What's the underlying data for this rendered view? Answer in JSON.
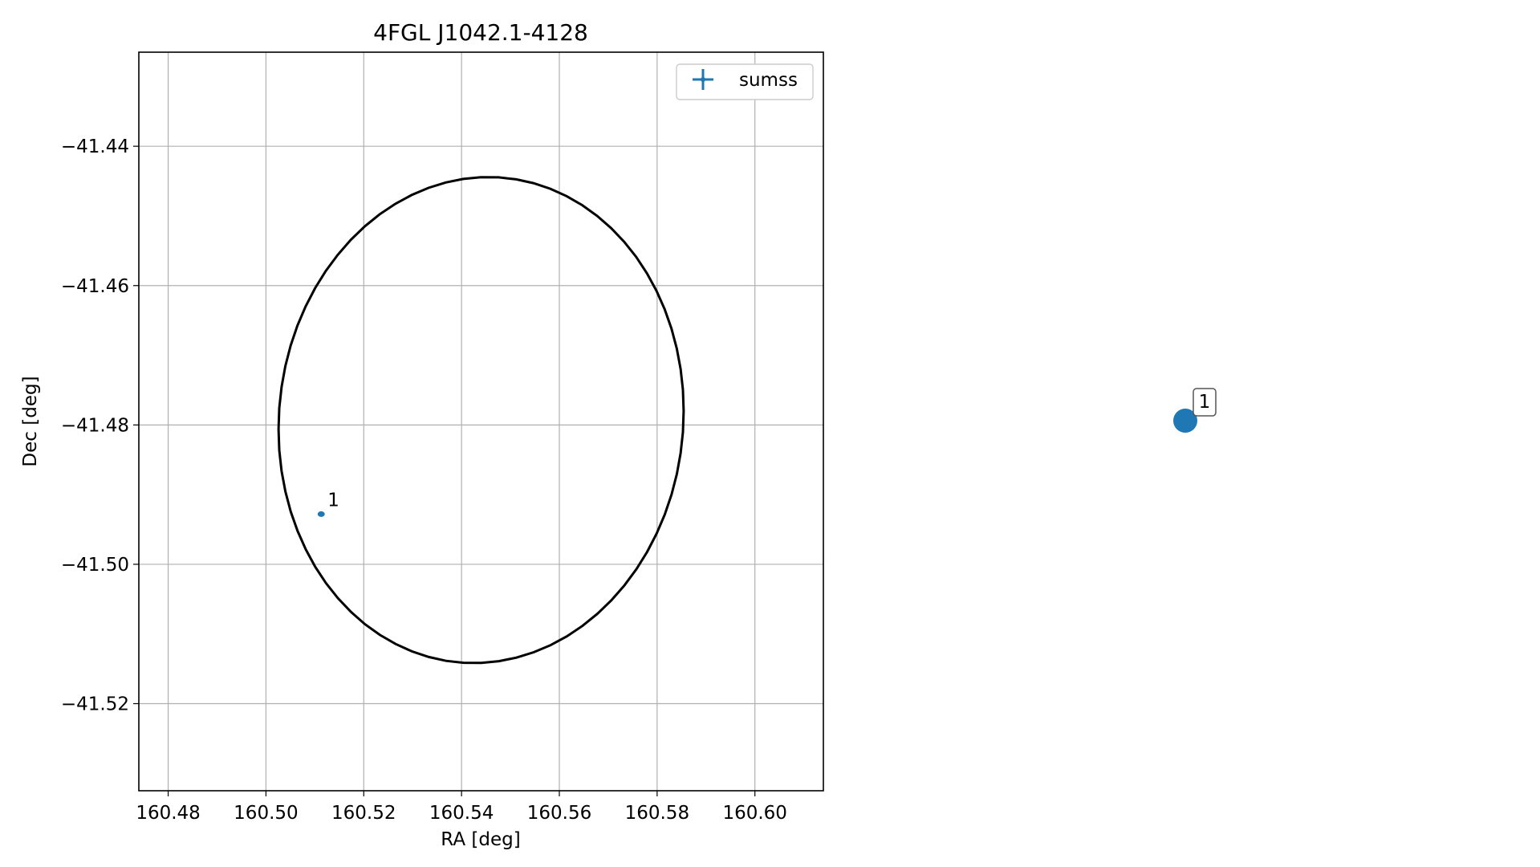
{
  "chart_data": [
    {
      "type": "scatter",
      "title": "4FGL J1042.1-4128",
      "xlabel": "RA [deg]",
      "ylabel": "Dec [deg]",
      "xlim": [
        160.474,
        160.614
      ],
      "ylim": [
        -41.5325,
        -41.4265
      ],
      "xticks": [
        160.48,
        160.5,
        160.52,
        160.54,
        160.56,
        160.58,
        160.6
      ],
      "xtick_labels": [
        "160.48",
        "160.50",
        "160.52",
        "160.54",
        "160.56",
        "160.58",
        "160.60"
      ],
      "yticks": [
        -41.44,
        -41.46,
        -41.48,
        -41.5,
        -41.52
      ],
      "ytick_labels": [
        "−41.44",
        "−41.46",
        "−41.48",
        "−41.50",
        "−41.52"
      ],
      "grid": true,
      "legend": {
        "placement": "top-right",
        "entries": [
          {
            "label": "sumss",
            "color": "#1f77b4"
          }
        ]
      },
      "ellipse": {
        "center_ra": 160.544,
        "center_dec": -41.4793,
        "semi_ra": 0.0415,
        "semi_dec": 0.0348,
        "angle_deg": 6,
        "color": "#000000"
      },
      "series": [
        {
          "name": "sumss",
          "color": "#1f77b4",
          "points": [
            {
              "ra": 160.5113,
              "dec": -41.4928,
              "label": "1"
            }
          ]
        }
      ]
    },
    {
      "type": "scatter",
      "points": [
        {
          "label": "1",
          "color": "#1f77b4"
        }
      ]
    }
  ]
}
